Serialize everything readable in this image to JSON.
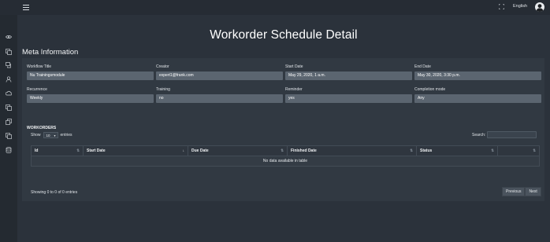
{
  "header": {
    "language": "English",
    "menu_icon": "hamburger-icon",
    "expand_icon": "expand-icon",
    "avatar_icon": "user-avatar"
  },
  "sidebar": {
    "icons": [
      "eye-icon",
      "copy-icon",
      "chat-icon",
      "user-icon",
      "cloud-icon",
      "copy-icon",
      "clipboard-icon",
      "copy-icon",
      "database-icon"
    ]
  },
  "page_title": "Workorder Schedule Detail",
  "meta": {
    "section_title": "Meta Information",
    "fields": [
      {
        "label": "Workflow Title",
        "value": "Nu Trainingsmodule"
      },
      {
        "label": "Creator",
        "value": "expert1@frank.com"
      },
      {
        "label": "Start Date",
        "value": "May 29, 2020, 1 a.m."
      },
      {
        "label": "End Date",
        "value": "May 30, 2020, 3:30 p.m."
      },
      {
        "label": "Recurrence",
        "value": "Weekly"
      },
      {
        "label": "Training",
        "value": "no"
      },
      {
        "label": "Reminder",
        "value": "yes"
      },
      {
        "label": "Completion mode",
        "value": "Any"
      }
    ]
  },
  "workorders": {
    "title": "WORKORDERS",
    "show_label": "Show",
    "entries_value": "10",
    "entries_label": "entries",
    "search_label": "Search:",
    "search_value": "",
    "columns": [
      "Id",
      "Start Date",
      "Due Date",
      "Finished Date",
      "Status",
      ""
    ],
    "empty_text": "No data available in table",
    "info_text": "Showing 0 to 0 of 0 entries",
    "prev_label": "Previous",
    "next_label": "Next"
  },
  "colors": {
    "background": "#2b323b",
    "card": "#313942",
    "field": "#5b6570"
  }
}
